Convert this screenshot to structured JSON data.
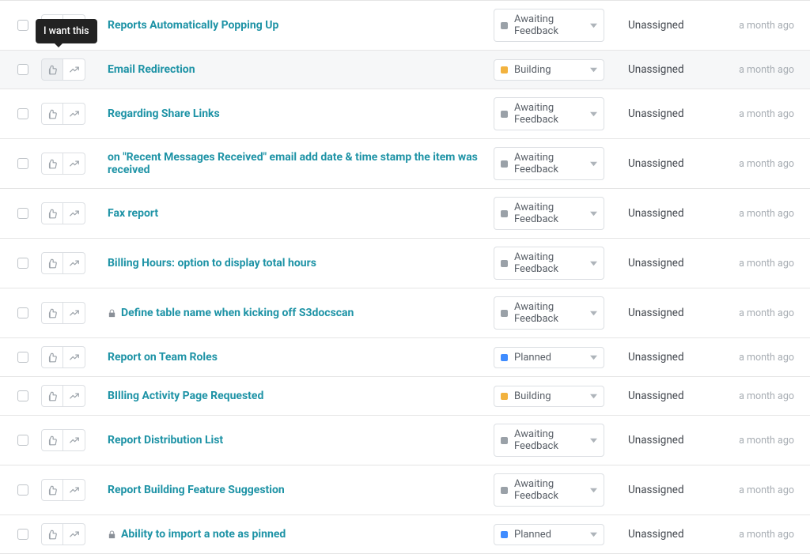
{
  "tooltip": "I want this",
  "status_colors": {
    "awaiting": "#9aa1a8",
    "building": "#f2b23e",
    "planned": "#3f8cff"
  },
  "rows": [
    {
      "title": "Reports Automatically Popping Up",
      "status_label": "Awaiting Feedback",
      "status_key": "awaiting",
      "assignee": "Unassigned",
      "time": "a month ago",
      "locked": false,
      "highlight": false,
      "vote_active": false
    },
    {
      "title": "Email Redirection",
      "status_label": "Building",
      "status_key": "building",
      "assignee": "Unassigned",
      "time": "a month ago",
      "locked": false,
      "highlight": true,
      "vote_active": true
    },
    {
      "title": "Regarding Share Links",
      "status_label": "Awaiting Feedback",
      "status_key": "awaiting",
      "assignee": "Unassigned",
      "time": "a month ago",
      "locked": false,
      "highlight": false,
      "vote_active": false
    },
    {
      "title": "on \"Recent Messages Received\" email add date & time stamp the item was received",
      "status_label": "Awaiting Feedback",
      "status_key": "awaiting",
      "assignee": "Unassigned",
      "time": "a month ago",
      "locked": false,
      "highlight": false,
      "vote_active": false
    },
    {
      "title": "Fax report",
      "status_label": "Awaiting Feedback",
      "status_key": "awaiting",
      "assignee": "Unassigned",
      "time": "a month ago",
      "locked": false,
      "highlight": false,
      "vote_active": false
    },
    {
      "title": "Billing Hours: option to display total hours",
      "status_label": "Awaiting Feedback",
      "status_key": "awaiting",
      "assignee": "Unassigned",
      "time": "a month ago",
      "locked": false,
      "highlight": false,
      "vote_active": false
    },
    {
      "title": "Define table name when kicking off S3docscan",
      "status_label": "Awaiting Feedback",
      "status_key": "awaiting",
      "assignee": "Unassigned",
      "time": "a month ago",
      "locked": true,
      "highlight": false,
      "vote_active": false
    },
    {
      "title": "Report on Team Roles",
      "status_label": "Planned",
      "status_key": "planned",
      "assignee": "Unassigned",
      "time": "a month ago",
      "locked": false,
      "highlight": false,
      "vote_active": false
    },
    {
      "title": "BIlling Activity Page Requested",
      "status_label": "Building",
      "status_key": "building",
      "assignee": "Unassigned",
      "time": "a month ago",
      "locked": false,
      "highlight": false,
      "vote_active": false
    },
    {
      "title": "Report Distribution List",
      "status_label": "Awaiting Feedback",
      "status_key": "awaiting",
      "assignee": "Unassigned",
      "time": "a month ago",
      "locked": false,
      "highlight": false,
      "vote_active": false
    },
    {
      "title": "Report Building Feature Suggestion",
      "status_label": "Awaiting Feedback",
      "status_key": "awaiting",
      "assignee": "Unassigned",
      "time": "a month ago",
      "locked": false,
      "highlight": false,
      "vote_active": false
    },
    {
      "title": "Ability to import a note as pinned",
      "status_label": "Planned",
      "status_key": "planned",
      "assignee": "Unassigned",
      "time": "a month ago",
      "locked": true,
      "highlight": false,
      "vote_active": false
    }
  ]
}
